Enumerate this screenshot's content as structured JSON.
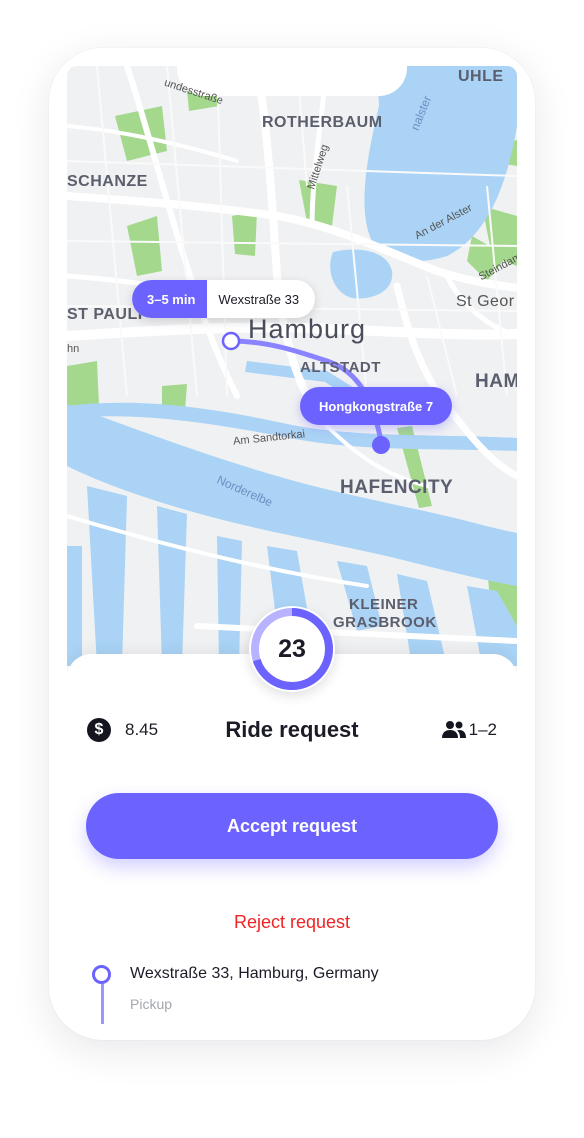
{
  "map": {
    "labels": {
      "uhle": "UHLE",
      "bundesstrasse": "undesstraße",
      "rotherbaum": "ROTHERBAUM",
      "alster_water": "nalster",
      "schanze": "SCHANZE",
      "mittelweg": "Mittelweg",
      "an_der_alster": "An der Alster",
      "steindamm": "Steindam",
      "st_georg": "St Geor",
      "st_pauli": "ST PAULI",
      "hamburg": "Hamburg",
      "altstadt": "ALTSTADT",
      "ham": "HAM",
      "am_sandtorkai": "Am Sandtorkai",
      "hafencity": "HAFENCITY",
      "norderelbe": "Norderelbe",
      "kleiner": "KLEINER",
      "grasbrook": "GRASBROOK",
      "left_hn": "hn"
    },
    "route_chip": {
      "eta": "3–5 min",
      "pickup": "Wexstraße 33"
    },
    "destination_chip": "Hongkongstraße 7",
    "colors": {
      "accent": "#6c63ff",
      "water": "#aad3f5",
      "park": "#a4d88c"
    }
  },
  "timer": {
    "value": "23",
    "progress": 0.3
  },
  "ride": {
    "fare": "8.45",
    "fare_icon": "dollar-coin-icon",
    "title": "Ride request",
    "seats": "1–2",
    "seats_icon": "people-icon"
  },
  "actions": {
    "accept_label": "Accept request",
    "reject_label": "Reject request"
  },
  "stop": {
    "address": "Wexstraße 33, Hamburg, Germany",
    "type": "Pickup"
  }
}
